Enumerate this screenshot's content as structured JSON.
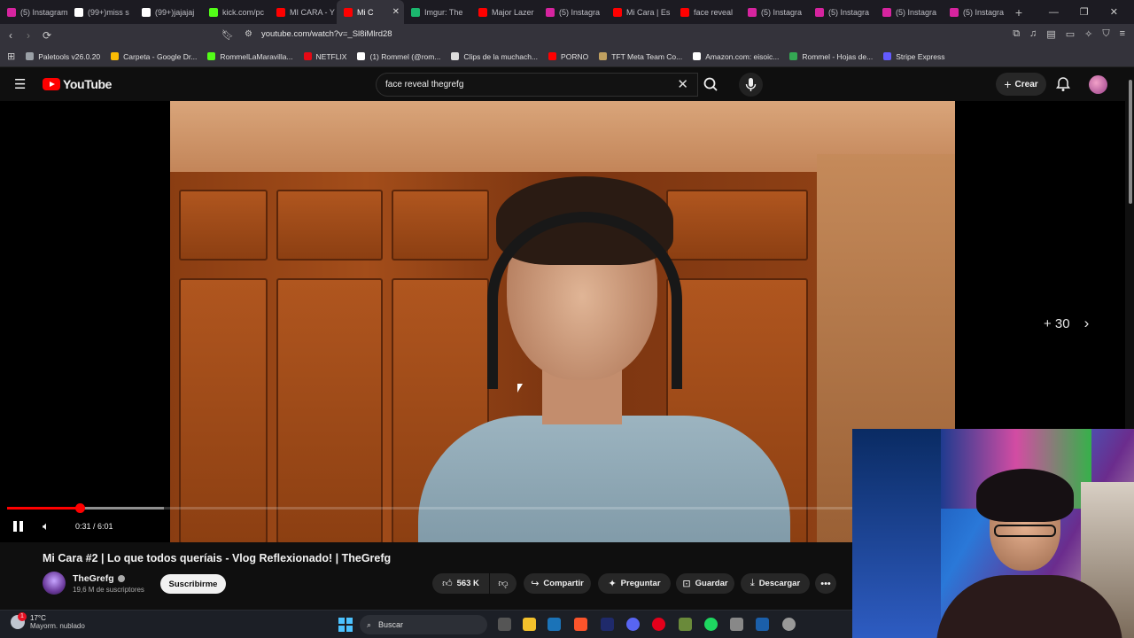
{
  "browser": {
    "tabs": [
      {
        "label": "(5) Instagram",
        "color": "#d6249f"
      },
      {
        "label": "(99+)miss s",
        "color": "#ffffff"
      },
      {
        "label": "(99+)jajajaj",
        "color": "#ffffff"
      },
      {
        "label": "kick.com/pc",
        "color": "#53fc18"
      },
      {
        "label": "MI CARA - Y",
        "color": "#ff0000"
      },
      {
        "label": "Mi C",
        "color": "#ff0000"
      },
      {
        "label": "Imgur: The",
        "color": "#1bb76e"
      },
      {
        "label": "Major Lazer",
        "color": "#ff0000"
      },
      {
        "label": "(5) Instagra",
        "color": "#d6249f"
      },
      {
        "label": "Mi Cara | Es",
        "color": "#ff0000"
      },
      {
        "label": "face reveal",
        "color": "#ff0000"
      },
      {
        "label": "(5) Instagra",
        "color": "#d6249f"
      },
      {
        "label": "(5) Instagra",
        "color": "#d6249f"
      },
      {
        "label": "(5) Instagra",
        "color": "#d6249f"
      },
      {
        "label": "(5) Instagra",
        "color": "#d6249f"
      }
    ],
    "active_tab_index": 5,
    "url": "youtube.com/watch?v=_Sl8iMlrd28",
    "bookmarks": [
      {
        "label": "Paletools v26.0.20",
        "color": "#9aa0a6"
      },
      {
        "label": "Carpeta - Google Dr...",
        "color": "#fbbc04"
      },
      {
        "label": "RommelLaMaravilla...",
        "color": "#53fc18"
      },
      {
        "label": "NETFLIX",
        "color": "#e50914"
      },
      {
        "label": "(1) Rommel (@rom...",
        "color": "#ffffff"
      },
      {
        "label": "Clips de la muchach...",
        "color": "#dddddd"
      },
      {
        "label": "PORNO",
        "color": "#ff0000"
      },
      {
        "label": "TFT Meta Team Co...",
        "color": "#c0a060"
      },
      {
        "label": "Amazon.com: eisoic...",
        "color": "#ffffff"
      },
      {
        "label": "Rommel - Hojas de...",
        "color": "#34a853"
      },
      {
        "label": "Stripe Express",
        "color": "#635bff"
      }
    ]
  },
  "youtube": {
    "logo_text": "YouTube",
    "search_query": "face reveal thegrefg",
    "create_label": "Crear",
    "skip_label": "+ 30",
    "time_display": "0:31 / 6:01",
    "progress_played": 0.0859,
    "progress_buffered": 0.186,
    "video_title": "Mi Cara #2 | Lo que todos queríais - Vlog Reflexionado! | TheGrefg",
    "channel_name": "TheGrefg",
    "subscribers": "19,6 M de suscriptores",
    "subscribe_label": "Suscribirme",
    "likes": "563 K",
    "share_label": "Compartir",
    "ask_label": "Preguntar",
    "save_label": "Guardar",
    "download_label": "Descargar"
  },
  "taskbar": {
    "temperature": "17°C",
    "weather": "Mayorm. nublado",
    "search_label": "Buscar",
    "badge_count": "1"
  }
}
